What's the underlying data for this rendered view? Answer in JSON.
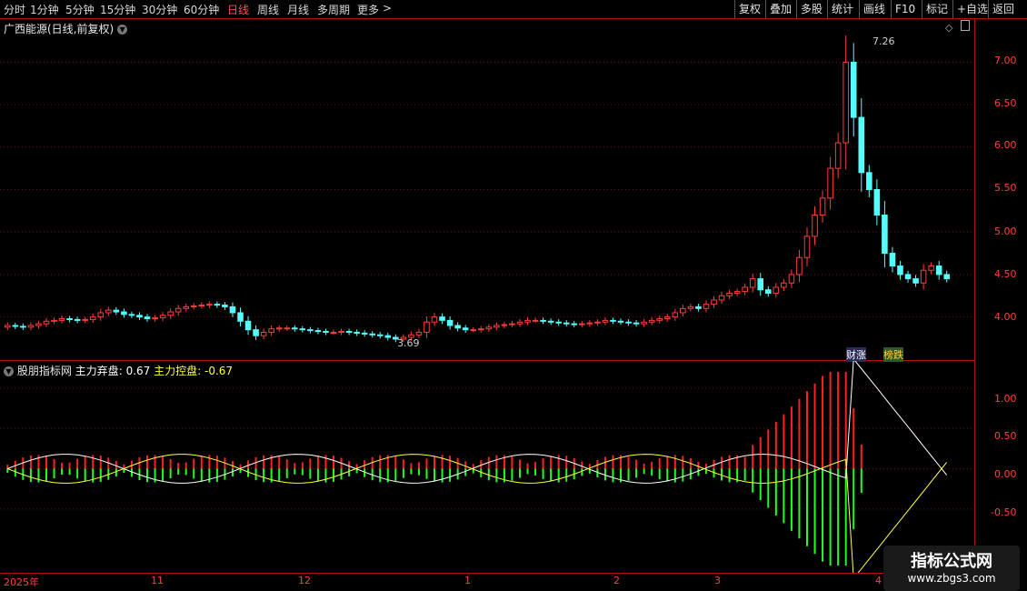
{
  "toolbar": {
    "periods": [
      "分时",
      "1分钟",
      "5分钟",
      "15分钟",
      "30分钟",
      "60分钟",
      "日线",
      "周线",
      "月线",
      "多周期",
      "更多"
    ],
    "active_period": "日线",
    "more_arrow": ">",
    "buttons": [
      "复权",
      "叠加",
      "多股",
      "统计",
      "画线",
      "F10",
      "标记",
      "+自选",
      "返回"
    ]
  },
  "main_chart": {
    "title": "广西能源(日线,前复权)",
    "high_label": "7.26",
    "low_label": "3.69",
    "tag_finance": "财涨",
    "tag_list": "榜跌",
    "y_ticks": [
      "7.00",
      "6.50",
      "6.00",
      "5.50",
      "5.00",
      "4.50",
      "4.00"
    ],
    "colors": {
      "up": "#ff3c3c",
      "down": "#54ffff",
      "axis": "#b01010"
    }
  },
  "indicator": {
    "name": "股朋指标网",
    "line1_label": "主力弃盘",
    "line1_value": "0.67",
    "line2_label": "主力控盘",
    "line2_value": "-0.67",
    "y_ticks": [
      "1.00",
      "0.50",
      "0.00",
      "-0.50"
    ],
    "colors": {
      "red": "#ff2020",
      "green": "#20ff20",
      "line1": "#ffffff",
      "line2": "#ffff40"
    }
  },
  "date_axis": {
    "labels": [
      "2025年",
      "11",
      "12",
      "1",
      "2",
      "3",
      "4"
    ]
  },
  "watermark": {
    "title": "指标公式网",
    "url": "www.zbgs3.com"
  },
  "chart_data": {
    "type": "bar",
    "title": "广西能源(日线,前复权)",
    "candles_close": [
      3.9,
      3.89,
      3.88,
      3.9,
      3.92,
      3.95,
      3.96,
      3.98,
      3.97,
      3.96,
      3.97,
      4.0,
      4.05,
      4.08,
      4.06,
      4.03,
      4.02,
      4.0,
      3.98,
      3.99,
      4.02,
      4.06,
      4.1,
      4.12,
      4.13,
      4.14,
      4.15,
      4.14,
      4.12,
      4.05,
      3.95,
      3.85,
      3.78,
      3.82,
      3.86,
      3.87,
      3.87,
      3.86,
      3.85,
      3.84,
      3.83,
      3.82,
      3.82,
      3.83,
      3.82,
      3.81,
      3.8,
      3.79,
      3.78,
      3.76,
      3.74,
      3.76,
      3.79,
      3.82,
      3.94,
      4.0,
      3.96,
      3.9,
      3.87,
      3.85,
      3.85,
      3.86,
      3.88,
      3.9,
      3.91,
      3.92,
      3.94,
      3.96,
      3.96,
      3.95,
      3.94,
      3.93,
      3.92,
      3.91,
      3.92,
      3.93,
      3.94,
      3.96,
      3.95,
      3.94,
      3.93,
      3.92,
      3.94,
      3.96,
      3.98,
      4.0,
      4.05,
      4.1,
      4.12,
      4.1,
      4.15,
      4.2,
      4.25,
      4.28,
      4.3,
      4.35,
      4.45,
      4.32,
      4.28,
      4.35,
      4.4,
      4.5,
      4.7,
      4.95,
      5.2,
      5.4,
      5.75,
      6.05,
      7.0,
      6.35,
      5.7,
      5.5,
      5.2,
      4.75,
      4.6,
      4.5,
      4.45,
      4.4,
      4.55,
      4.6,
      4.5,
      4.45
    ],
    "indicator_series": [
      {
        "name": "主力弃盘",
        "last_value": 0.67
      },
      {
        "name": "主力控盘",
        "last_value": -0.67
      }
    ],
    "ylim_main": [
      3.6,
      7.4
    ],
    "ylim_indicator": [
      -1.2,
      1.2
    ]
  }
}
